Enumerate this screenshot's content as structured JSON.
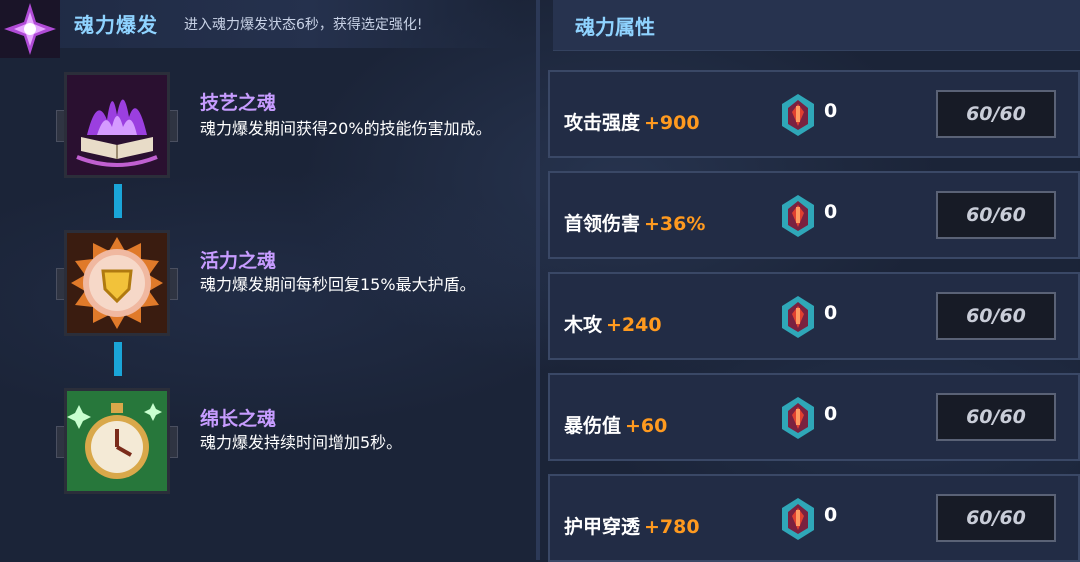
{
  "burst": {
    "title": "魂力爆发",
    "description": "进入魂力爆发状态6秒，获得选定强化!"
  },
  "attributes_panel": {
    "title": "魂力属性"
  },
  "souls": [
    {
      "name": "技艺之魂",
      "text": "魂力爆发期间获得20%的技能伤害加成。",
      "icon": "purple-flame-book-icon"
    },
    {
      "name": "活力之魂",
      "text": "魂力爆发期间每秒回复15%最大护盾。",
      "icon": "golden-shield-icon"
    },
    {
      "name": "绵长之魂",
      "text": "魂力爆发持续时间增加5秒。",
      "icon": "stopwatch-icon"
    }
  ],
  "attributes": [
    {
      "label": "攻击强度",
      "bonus": "+900",
      "gems": "0",
      "level": "60/60"
    },
    {
      "label": "首领伤害",
      "bonus": "+36%",
      "gems": "0",
      "level": "60/60"
    },
    {
      "label": "木攻",
      "bonus": "+240",
      "gems": "0",
      "level": "60/60"
    },
    {
      "label": "暴伤值",
      "bonus": "+60",
      "gems": "0",
      "level": "60/60"
    },
    {
      "label": "护甲穿透",
      "bonus": "+780",
      "gems": "0",
      "level": "60/60"
    }
  ],
  "colors": {
    "title_blue": "#8fd3ff",
    "soul_name_purple": "#c79cff",
    "bonus_orange": "#ff9a1f",
    "connector_cyan": "#1aa5d8"
  }
}
